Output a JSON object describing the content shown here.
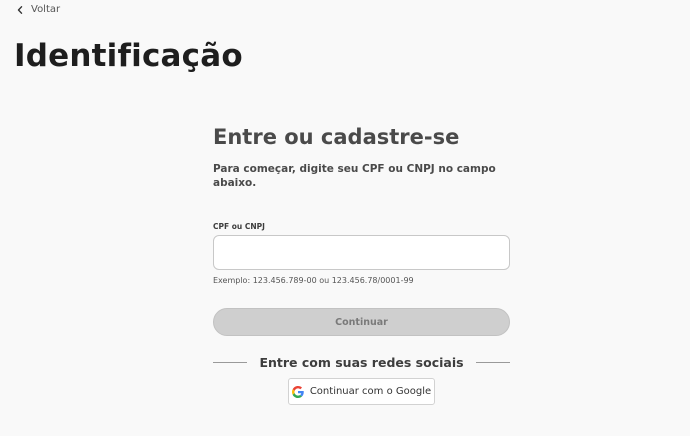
{
  "nav": {
    "back_label": "Voltar",
    "back_icon": "chevron-left-icon"
  },
  "page": {
    "title": "Identificação"
  },
  "login": {
    "heading": "Entre ou cadastre-se",
    "subtitle": "Para começar, digite seu CPF ou CNPJ no campo abaixo.",
    "field_label": "CPF ou CNPJ",
    "field_value": "",
    "field_placeholder": "",
    "field_hint": "Exemplo: 123.456.789-00 ou 123.456.78/0001-99",
    "continue_label": "Continuar",
    "continue_state": "disabled"
  },
  "social": {
    "divider_text": "Entre com suas redes sociais",
    "google_label": "Continuar com o Google",
    "google_icon": "google-icon",
    "colors": {
      "google_blue": "#4285F4",
      "google_red": "#EA4335",
      "google_yellow": "#FBBC05",
      "google_green": "#34A853"
    }
  },
  "colors": {
    "background": "#f9f9f9",
    "title_text": "#1e1e1e",
    "body_text": "#4a4a4a",
    "disabled_button": "#cfcfcf"
  }
}
